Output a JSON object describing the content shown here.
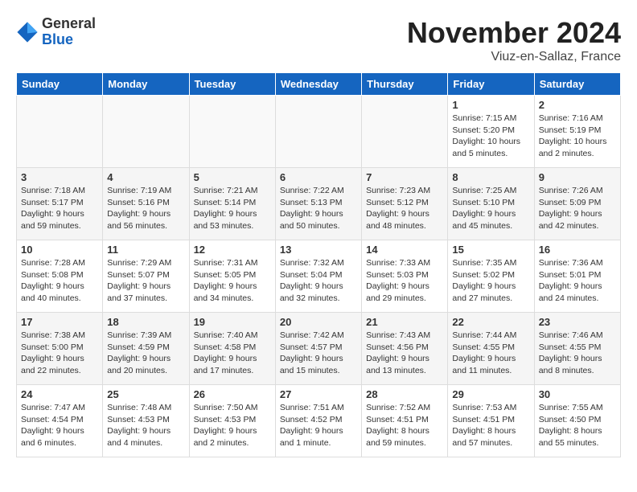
{
  "header": {
    "logo_general": "General",
    "logo_blue": "Blue",
    "month": "November 2024",
    "location": "Viuz-en-Sallaz, France"
  },
  "weekdays": [
    "Sunday",
    "Monday",
    "Tuesday",
    "Wednesday",
    "Thursday",
    "Friday",
    "Saturday"
  ],
  "weeks": [
    [
      {
        "day": "",
        "info": ""
      },
      {
        "day": "",
        "info": ""
      },
      {
        "day": "",
        "info": ""
      },
      {
        "day": "",
        "info": ""
      },
      {
        "day": "",
        "info": ""
      },
      {
        "day": "1",
        "info": "Sunrise: 7:15 AM\nSunset: 5:20 PM\nDaylight: 10 hours and 5 minutes."
      },
      {
        "day": "2",
        "info": "Sunrise: 7:16 AM\nSunset: 5:19 PM\nDaylight: 10 hours and 2 minutes."
      }
    ],
    [
      {
        "day": "3",
        "info": "Sunrise: 7:18 AM\nSunset: 5:17 PM\nDaylight: 9 hours and 59 minutes."
      },
      {
        "day": "4",
        "info": "Sunrise: 7:19 AM\nSunset: 5:16 PM\nDaylight: 9 hours and 56 minutes."
      },
      {
        "day": "5",
        "info": "Sunrise: 7:21 AM\nSunset: 5:14 PM\nDaylight: 9 hours and 53 minutes."
      },
      {
        "day": "6",
        "info": "Sunrise: 7:22 AM\nSunset: 5:13 PM\nDaylight: 9 hours and 50 minutes."
      },
      {
        "day": "7",
        "info": "Sunrise: 7:23 AM\nSunset: 5:12 PM\nDaylight: 9 hours and 48 minutes."
      },
      {
        "day": "8",
        "info": "Sunrise: 7:25 AM\nSunset: 5:10 PM\nDaylight: 9 hours and 45 minutes."
      },
      {
        "day": "9",
        "info": "Sunrise: 7:26 AM\nSunset: 5:09 PM\nDaylight: 9 hours and 42 minutes."
      }
    ],
    [
      {
        "day": "10",
        "info": "Sunrise: 7:28 AM\nSunset: 5:08 PM\nDaylight: 9 hours and 40 minutes."
      },
      {
        "day": "11",
        "info": "Sunrise: 7:29 AM\nSunset: 5:07 PM\nDaylight: 9 hours and 37 minutes."
      },
      {
        "day": "12",
        "info": "Sunrise: 7:31 AM\nSunset: 5:05 PM\nDaylight: 9 hours and 34 minutes."
      },
      {
        "day": "13",
        "info": "Sunrise: 7:32 AM\nSunset: 5:04 PM\nDaylight: 9 hours and 32 minutes."
      },
      {
        "day": "14",
        "info": "Sunrise: 7:33 AM\nSunset: 5:03 PM\nDaylight: 9 hours and 29 minutes."
      },
      {
        "day": "15",
        "info": "Sunrise: 7:35 AM\nSunset: 5:02 PM\nDaylight: 9 hours and 27 minutes."
      },
      {
        "day": "16",
        "info": "Sunrise: 7:36 AM\nSunset: 5:01 PM\nDaylight: 9 hours and 24 minutes."
      }
    ],
    [
      {
        "day": "17",
        "info": "Sunrise: 7:38 AM\nSunset: 5:00 PM\nDaylight: 9 hours and 22 minutes."
      },
      {
        "day": "18",
        "info": "Sunrise: 7:39 AM\nSunset: 4:59 PM\nDaylight: 9 hours and 20 minutes."
      },
      {
        "day": "19",
        "info": "Sunrise: 7:40 AM\nSunset: 4:58 PM\nDaylight: 9 hours and 17 minutes."
      },
      {
        "day": "20",
        "info": "Sunrise: 7:42 AM\nSunset: 4:57 PM\nDaylight: 9 hours and 15 minutes."
      },
      {
        "day": "21",
        "info": "Sunrise: 7:43 AM\nSunset: 4:56 PM\nDaylight: 9 hours and 13 minutes."
      },
      {
        "day": "22",
        "info": "Sunrise: 7:44 AM\nSunset: 4:55 PM\nDaylight: 9 hours and 11 minutes."
      },
      {
        "day": "23",
        "info": "Sunrise: 7:46 AM\nSunset: 4:55 PM\nDaylight: 9 hours and 8 minutes."
      }
    ],
    [
      {
        "day": "24",
        "info": "Sunrise: 7:47 AM\nSunset: 4:54 PM\nDaylight: 9 hours and 6 minutes."
      },
      {
        "day": "25",
        "info": "Sunrise: 7:48 AM\nSunset: 4:53 PM\nDaylight: 9 hours and 4 minutes."
      },
      {
        "day": "26",
        "info": "Sunrise: 7:50 AM\nSunset: 4:53 PM\nDaylight: 9 hours and 2 minutes."
      },
      {
        "day": "27",
        "info": "Sunrise: 7:51 AM\nSunset: 4:52 PM\nDaylight: 9 hours and 1 minute."
      },
      {
        "day": "28",
        "info": "Sunrise: 7:52 AM\nSunset: 4:51 PM\nDaylight: 8 hours and 59 minutes."
      },
      {
        "day": "29",
        "info": "Sunrise: 7:53 AM\nSunset: 4:51 PM\nDaylight: 8 hours and 57 minutes."
      },
      {
        "day": "30",
        "info": "Sunrise: 7:55 AM\nSunset: 4:50 PM\nDaylight: 8 hours and 55 minutes."
      }
    ]
  ]
}
